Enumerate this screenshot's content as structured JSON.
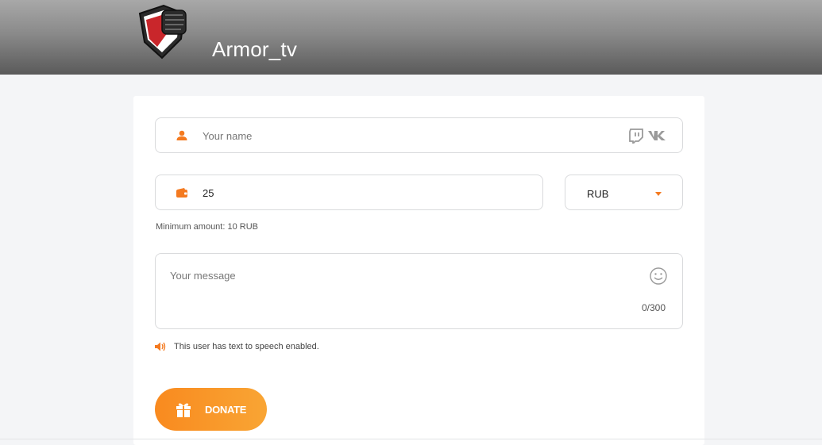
{
  "header": {
    "channel_name": "Armor_tv",
    "logo_icon": "fist-shield-logo"
  },
  "form": {
    "name": {
      "placeholder": "Your name",
      "value": "",
      "icon": "user-icon"
    },
    "social_icons": [
      "twitch-icon",
      "vk-icon"
    ],
    "amount": {
      "value": "25",
      "icon": "wallet-icon"
    },
    "currency": {
      "selected": "RUB"
    },
    "min_amount_text": "Minimum amount: 10 RUB",
    "message": {
      "placeholder": "Your message",
      "value": "",
      "counter": "0/300"
    },
    "tts_notice": "This user has text to speech enabled.",
    "donate_label": "DONATE"
  },
  "colors": {
    "accent": "#f47a20",
    "button_gradient_start": "#f98a1f",
    "button_gradient_end": "#f9a534"
  }
}
